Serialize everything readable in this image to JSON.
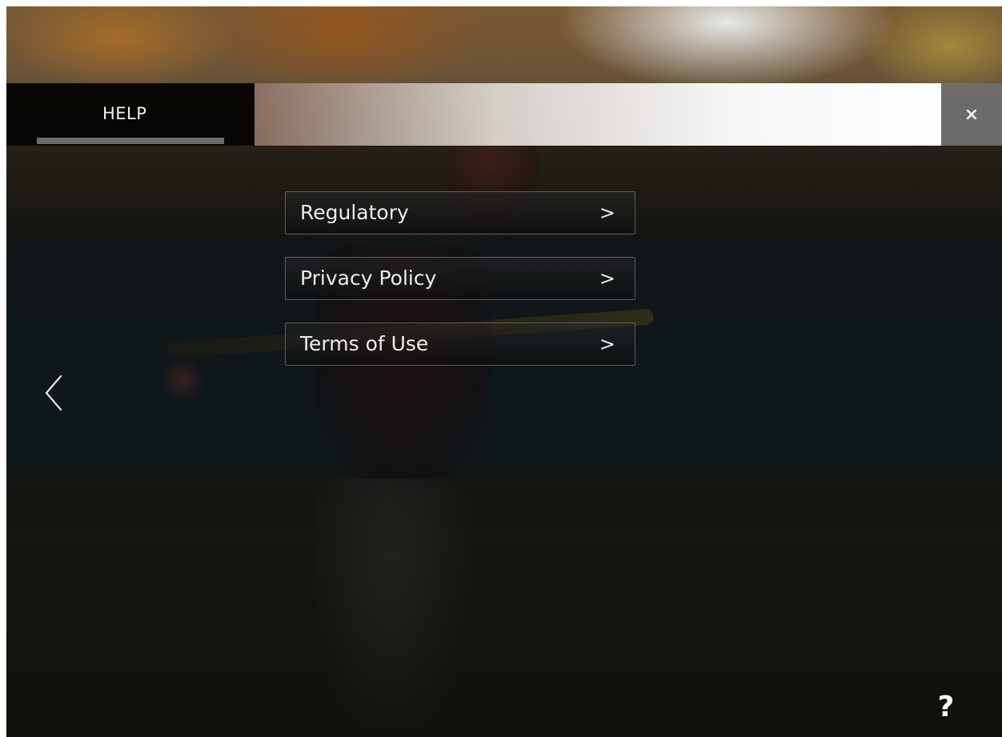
{
  "header": {
    "tab_label": "HELP",
    "close_symbol": "×"
  },
  "menu": {
    "items": [
      {
        "label": "Regulatory",
        "chevron": ">"
      },
      {
        "label": "Privacy Policy",
        "chevron": ">"
      },
      {
        "label": "Terms of Use",
        "chevron": ">"
      }
    ]
  },
  "help_button": {
    "symbol": "?"
  },
  "icons": {
    "back": "chevron-left-icon",
    "close": "close-icon",
    "help": "question-mark-icon"
  },
  "colors": {
    "overlay": "#000000",
    "text": "#ececec",
    "tab_underline": "#6b6b6b",
    "close_bg": "#787878"
  }
}
